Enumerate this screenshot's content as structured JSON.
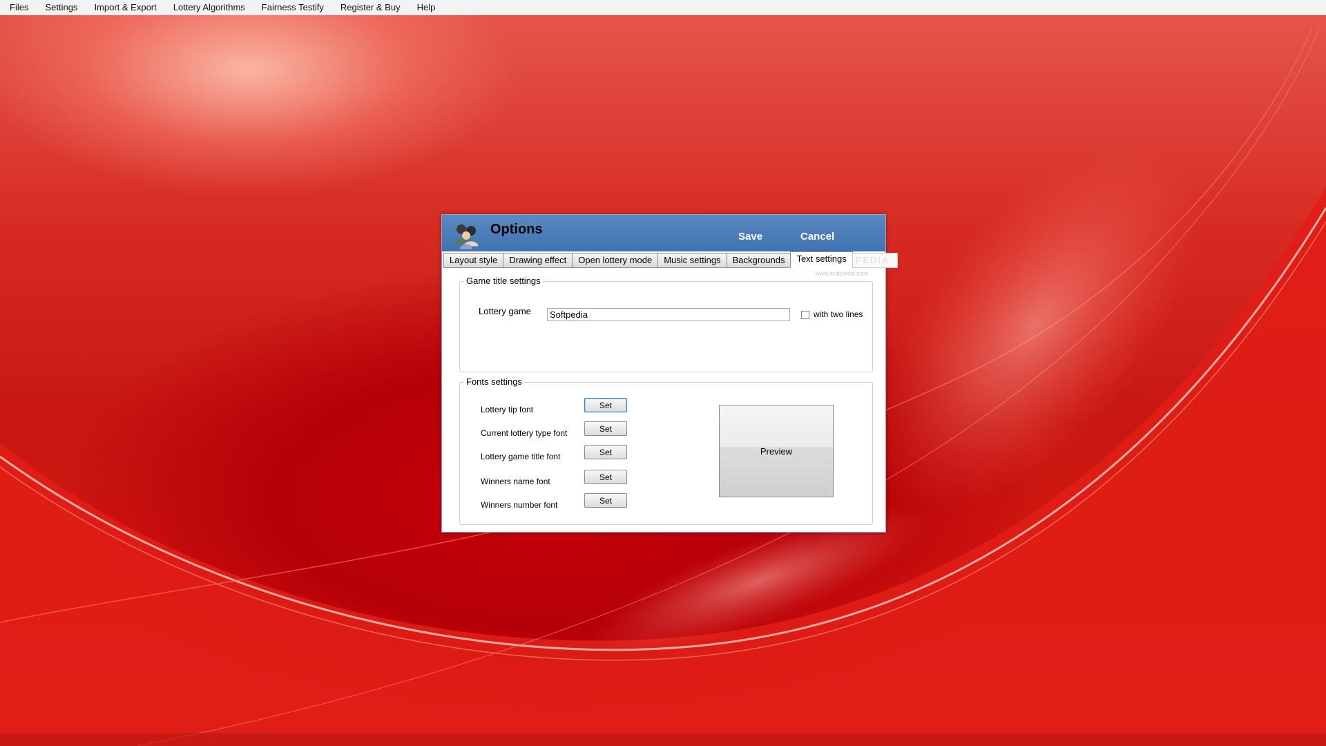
{
  "menu": [
    "Files",
    "Settings",
    "Import & Export",
    "Lottery Algorithms",
    "Fairness Testify",
    "Register & Buy",
    "Help"
  ],
  "dialog": {
    "title": "Options",
    "save_label": "Save",
    "cancel_label": "Cancel",
    "tabs": [
      "Layout style",
      "Drawing effect",
      "Open lottery mode",
      "Music settings",
      "Backgrounds",
      "Text settings"
    ],
    "active_tab": "Text settings",
    "tab_ghost_text": "PEDIA",
    "watermark": "www.softpedia.com"
  },
  "game_title_settings": {
    "legend": "Game title settings",
    "lottery_game_label": "Lottery game",
    "lottery_game_value": "Softpedia",
    "two_lines_label": "with two lines",
    "two_lines_checked": false
  },
  "fonts_settings": {
    "legend": "Fonts settings",
    "rows": [
      {
        "label": "Lottery tip font",
        "button": "Set"
      },
      {
        "label": "Current lottery type font",
        "button": "Set"
      },
      {
        "label": "Lottery game title font",
        "button": "Set"
      },
      {
        "label": "Winners name font",
        "button": "Set"
      },
      {
        "label": "Winners number font",
        "button": "Set"
      }
    ],
    "preview_label": "Preview"
  },
  "colors": {
    "header_blue": "#4a7dbb",
    "background_red": "#d0140e"
  }
}
